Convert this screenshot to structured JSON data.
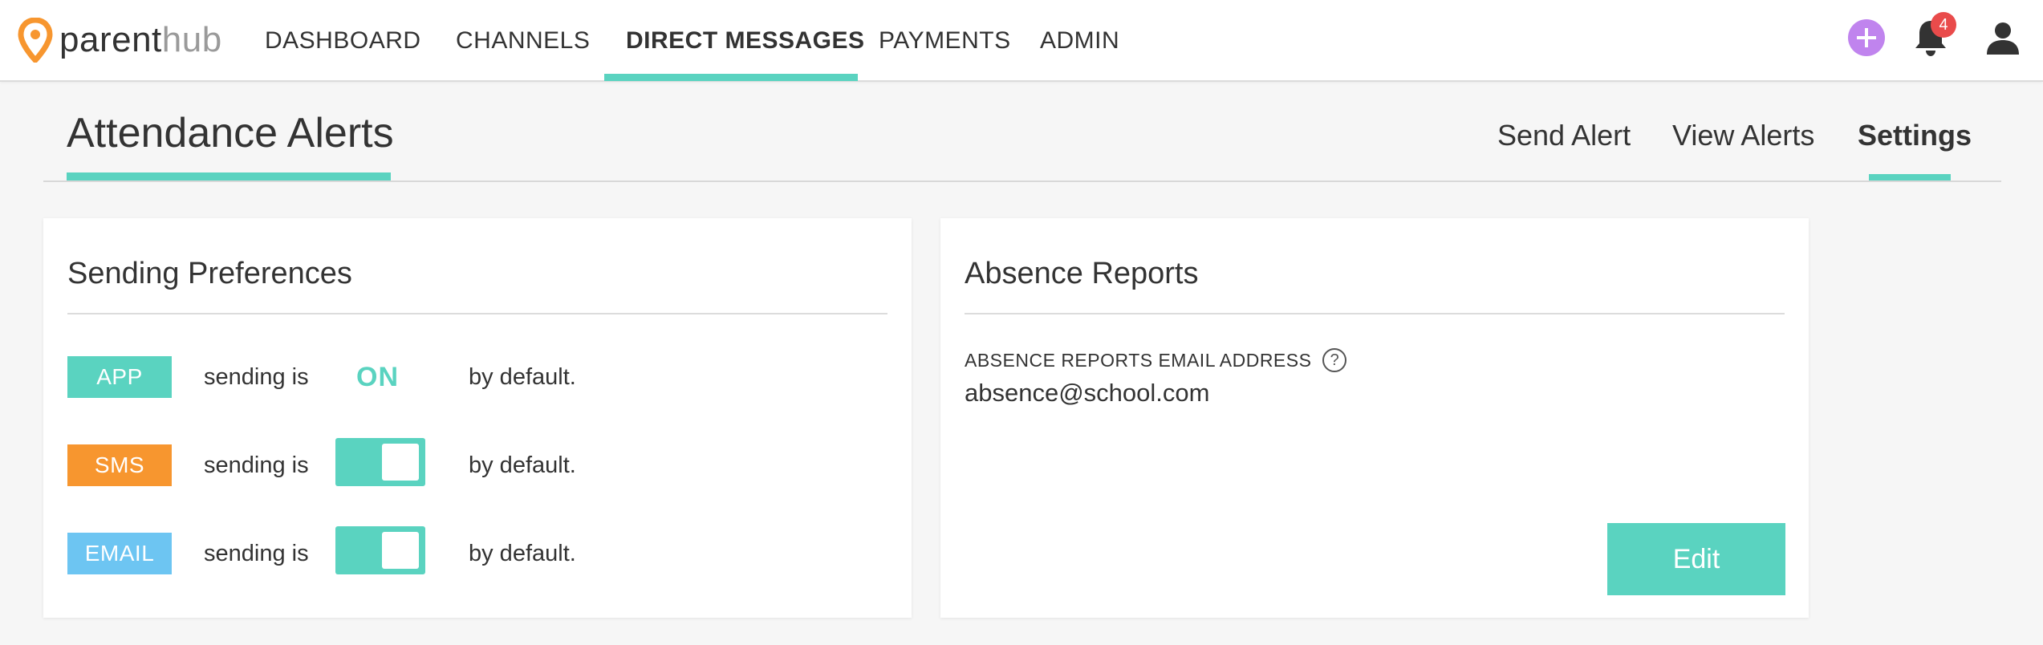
{
  "brand": {
    "part1": "parent",
    "part2": "hub"
  },
  "nav": {
    "items": [
      {
        "label": "DASHBOARD"
      },
      {
        "label": "CHANNELS"
      },
      {
        "label": "DIRECT MESSAGES"
      },
      {
        "label": "PAYMENTS"
      },
      {
        "label": "ADMIN"
      }
    ],
    "active": "DIRECT MESSAGES",
    "notification_count": "4"
  },
  "page": {
    "title": "Attendance Alerts",
    "tabs": [
      {
        "label": "Send Alert"
      },
      {
        "label": "View Alerts"
      },
      {
        "label": "Settings"
      }
    ],
    "active_tab": "Settings"
  },
  "sending_preferences": {
    "title": "Sending Preferences",
    "rows": [
      {
        "channel": "APP",
        "prefix": "sending is",
        "state_text": "ON",
        "suffix": "by default."
      },
      {
        "channel": "SMS",
        "prefix": "sending is",
        "toggle_on": true,
        "suffix": "by default."
      },
      {
        "channel": "EMAIL",
        "prefix": "sending is",
        "toggle_on": true,
        "suffix": "by default."
      }
    ]
  },
  "absence_reports": {
    "title": "Absence Reports",
    "field_label": "ABSENCE REPORTS EMAIL ADDRESS",
    "help_symbol": "?",
    "email": "absence@school.com",
    "edit_label": "Edit"
  },
  "colors": {
    "accent": "#5ad3c0",
    "sms": "#f7962f",
    "email": "#6dc5f2",
    "plus": "#c084ee",
    "badge": "#e94b4b",
    "logo": "#f7962f"
  }
}
